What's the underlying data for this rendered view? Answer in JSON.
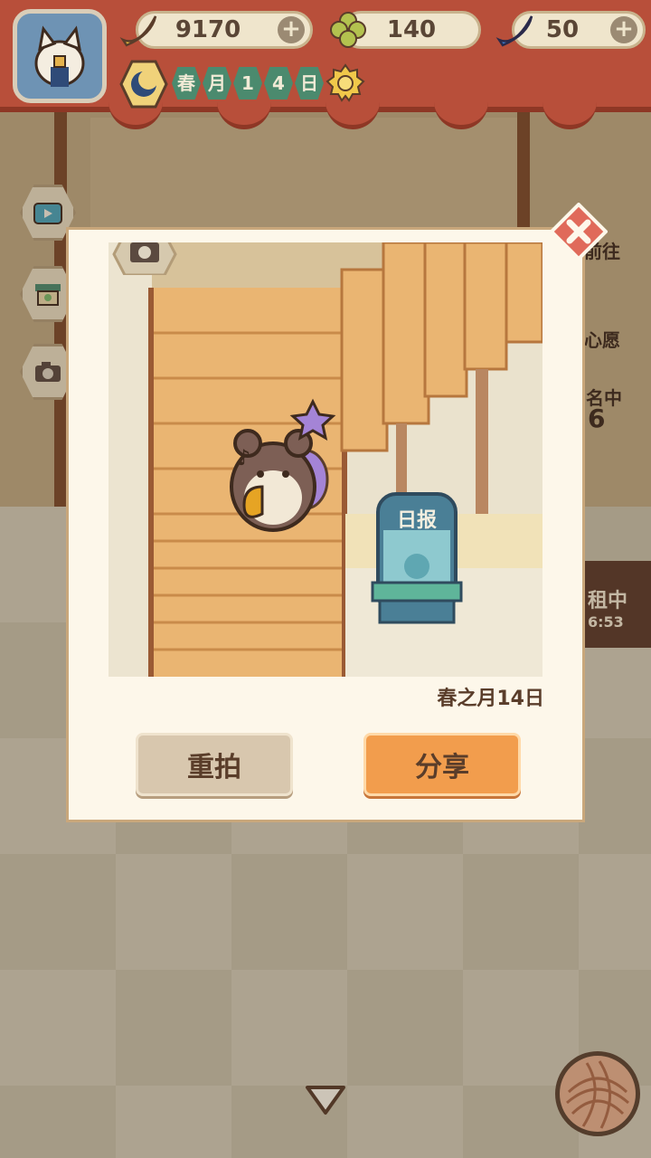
{
  "resources": [
    {
      "icon": "banana-icon",
      "value": "9170"
    },
    {
      "icon": "clover-icon",
      "value": "140"
    },
    {
      "icon": "blue-banana-icon",
      "value": "50"
    }
  ],
  "calendar": {
    "chars": [
      "春",
      "月",
      "1",
      "4",
      "日"
    ]
  },
  "background_labels": {
    "goto": "前往",
    "wish": "心愿",
    "rank_suffix": "名中",
    "rank_num": "6",
    "rent_status": "租中",
    "timer": "6:53"
  },
  "photo": {
    "newspaper_sign": "日报",
    "date_caption": "春之月14日"
  },
  "dialog": {
    "retake_label": "重拍",
    "share_label": "分享"
  },
  "colors": {
    "curtain": "#b84f3a",
    "accent_orange": "#f29d4d",
    "dialog_bg": "#fdf7ea"
  }
}
